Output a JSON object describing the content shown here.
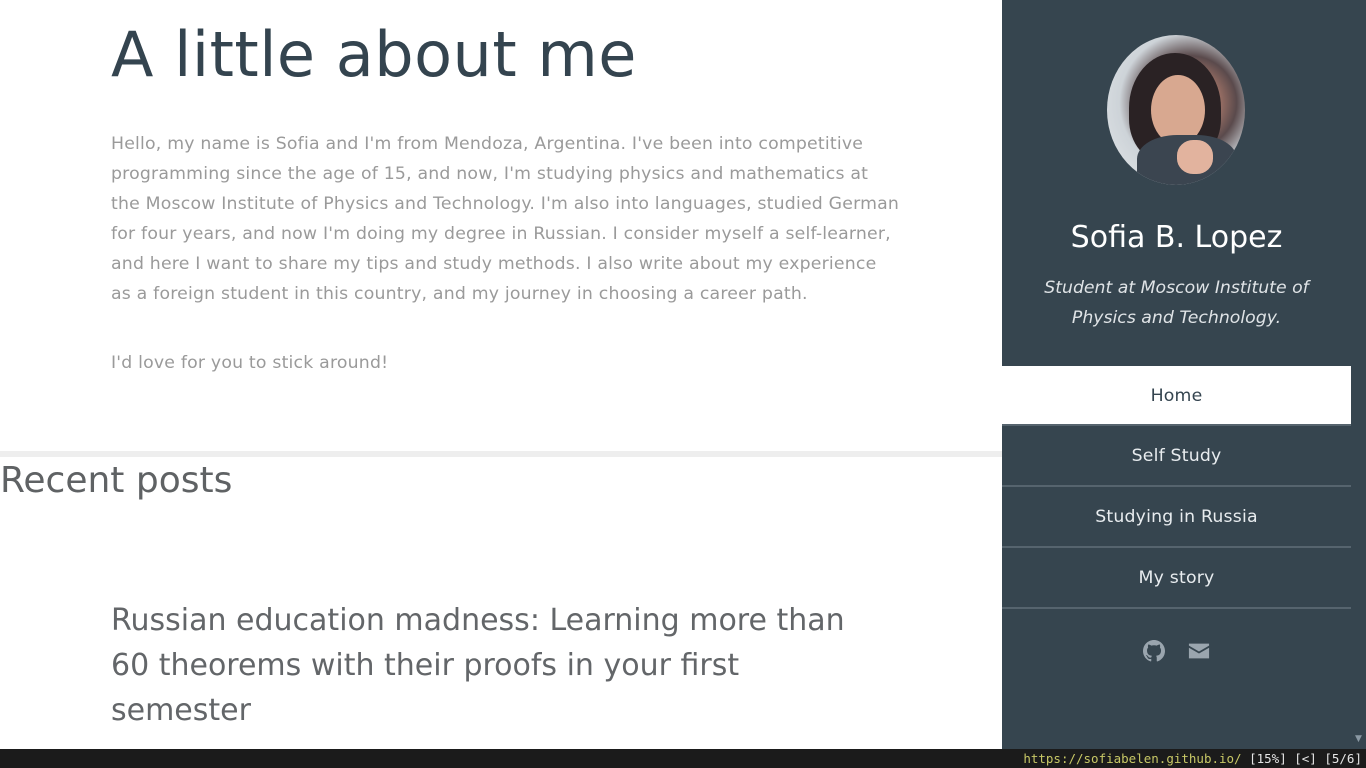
{
  "about": {
    "title": "A little about me",
    "text": "Hello, my name is Sofia and I'm from Mendoza, Argentina. I've been into competitive programming since the age of 15, and now, I'm studying physics and mathematics at the Moscow Institute of Physics and Technology. I'm also into languages, studied German for four years, and now I'm doing my degree in Russian. I consider myself a self-learner, and here I want to share my tips and study methods. I also write about my experience as a foreign student in this country, and my journey in choosing a career path.",
    "outro": "I'd love for you to stick around!"
  },
  "recent": {
    "title": "Recent posts",
    "posts": [
      {
        "title": "Russian education madness: Learning more than 60 theorems with their proofs in your first semester"
      }
    ]
  },
  "profile": {
    "name": "Sofia B. Lopez",
    "tagline": "Student at Moscow Institute of Physics and Technology."
  },
  "nav": {
    "items": [
      {
        "label": "Home",
        "active": true
      },
      {
        "label": "Self Study",
        "active": false
      },
      {
        "label": "Studying in Russia",
        "active": false
      },
      {
        "label": "My story",
        "active": false
      }
    ]
  },
  "social": {
    "icons": [
      "github-icon",
      "envelope-icon"
    ]
  },
  "statusbar": {
    "url": "https://sofiabelen.github.io/",
    "info": " [15%] [<] [5/6]"
  },
  "colors": {
    "sidebar_bg": "#36454f",
    "heading": "#34444f",
    "body_text": "#9a9a9a"
  }
}
